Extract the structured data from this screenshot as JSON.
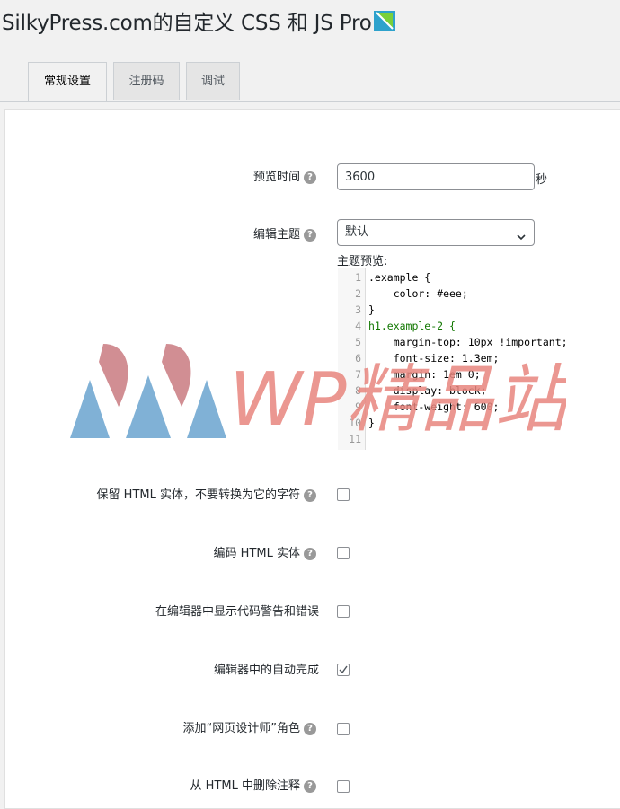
{
  "page": {
    "title": "SilkyPress.com的自定义 CSS 和 JS Pro",
    "brand_icon": "pro-badge-icon"
  },
  "tabs": [
    {
      "label": "常规设置",
      "active": true
    },
    {
      "label": "注册码",
      "active": false
    },
    {
      "label": "调试",
      "active": false
    }
  ],
  "fields": {
    "preview_time": {
      "label": "预览时间",
      "value": "3600",
      "unit": "秒"
    },
    "editor_theme": {
      "label": "编辑主题",
      "selected": "默认"
    },
    "theme_preview_label": "主题预览:"
  },
  "code_preview": {
    "line_numbers": [
      "1",
      "2",
      "3",
      "4",
      "5",
      "6",
      "7",
      "8",
      "9",
      "10",
      "11"
    ],
    "lines": [
      ".example {",
      "    color: #eee;",
      "}",
      "h1.example-2 {",
      "    margin-top: 10px !important;",
      "    font-size: 1.3em;",
      "    margin: 1em 0;",
      "    display: block;",
      "    font-weight: 600;",
      "}",
      ""
    ]
  },
  "checkboxes": [
    {
      "label": "保留 HTML 实体，不要转换为它的字符",
      "help": true,
      "checked": false
    },
    {
      "label": "编码 HTML 实体",
      "help": true,
      "checked": false
    },
    {
      "label": "在编辑器中显示代码警告和错误",
      "help": false,
      "checked": false
    },
    {
      "label": "编辑器中的自动完成",
      "help": false,
      "checked": true
    },
    {
      "label": "添加“网页设计师”角色",
      "help": true,
      "checked": false
    },
    {
      "label": "从 HTML 中删除注释",
      "help": true,
      "checked": false
    }
  ],
  "watermark": {
    "text": "WP精品站"
  },
  "colors": {
    "watermark_red": "#e8867e",
    "watermark_blue": "#6aa3cf",
    "watermark_pink": "#c97a80"
  }
}
